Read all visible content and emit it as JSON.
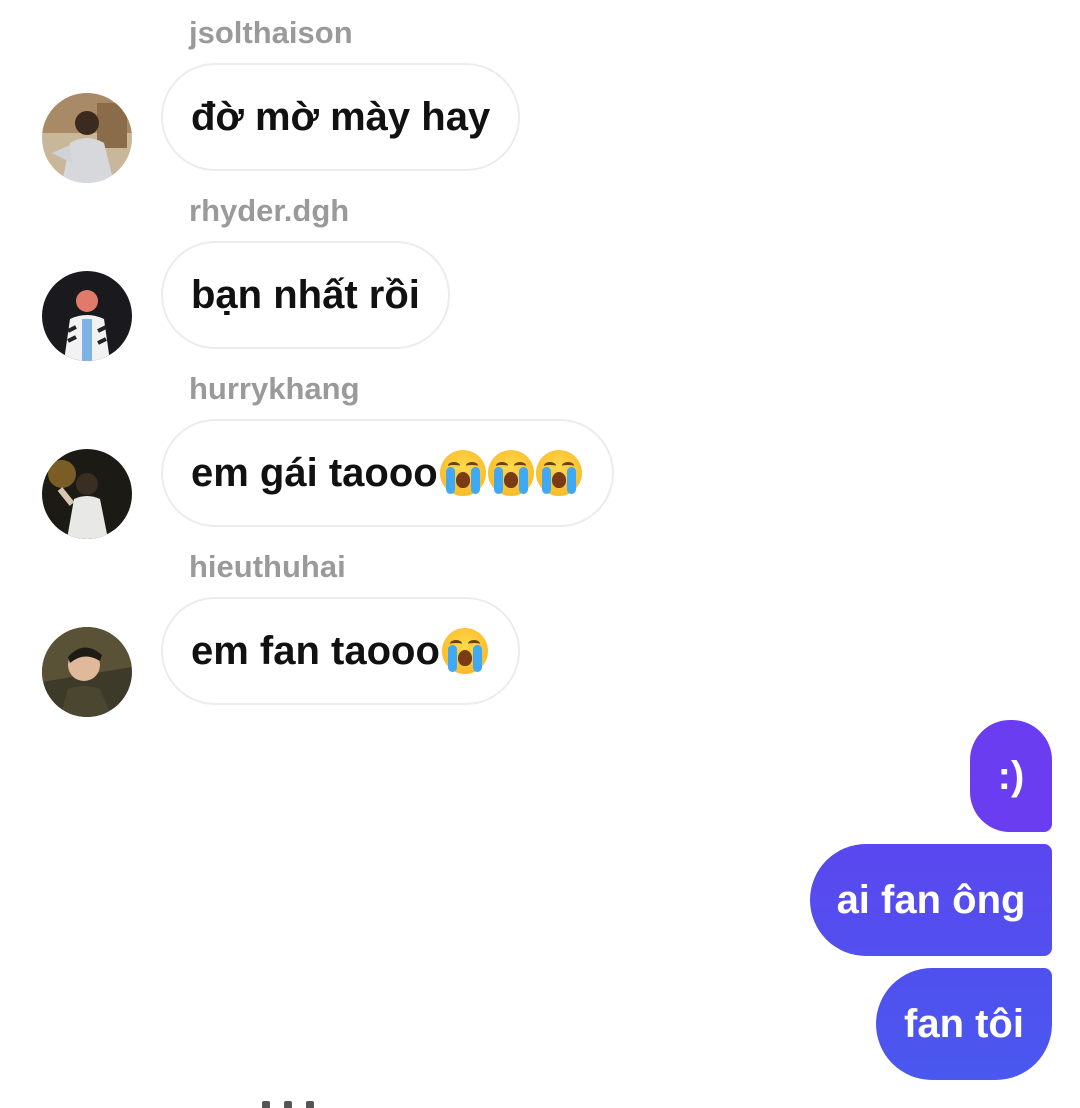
{
  "messages_incoming": [
    {
      "username": "jsolthaison",
      "text": "đờ mờ mày hay",
      "emoji_count": 0,
      "avatar": "avatar-jsolthaison"
    },
    {
      "username": "rhyder.dgh",
      "text": "bạn nhất rồi",
      "emoji_count": 0,
      "avatar": "avatar-rhyder"
    },
    {
      "username": "hurrykhang",
      "text": "em gái taooo",
      "emoji_count": 3,
      "emoji": "loudly-crying-face-emoji",
      "avatar": "avatar-hurrykhang"
    },
    {
      "username": "hieuthuhai",
      "text": "em fan taooo",
      "emoji_count": 1,
      "emoji": "loudly-crying-face-emoji",
      "avatar": "avatar-hieuthuhai"
    }
  ],
  "messages_outgoing": [
    {
      "text": ":)"
    },
    {
      "text": "ai fan ông"
    },
    {
      "text": "fan tôi"
    }
  ],
  "colors": {
    "username": "#9a9a9a",
    "incoming_border": "#ececec",
    "outgoing_top": "#6a3df0",
    "outgoing_bottom": "#4a58ef"
  }
}
